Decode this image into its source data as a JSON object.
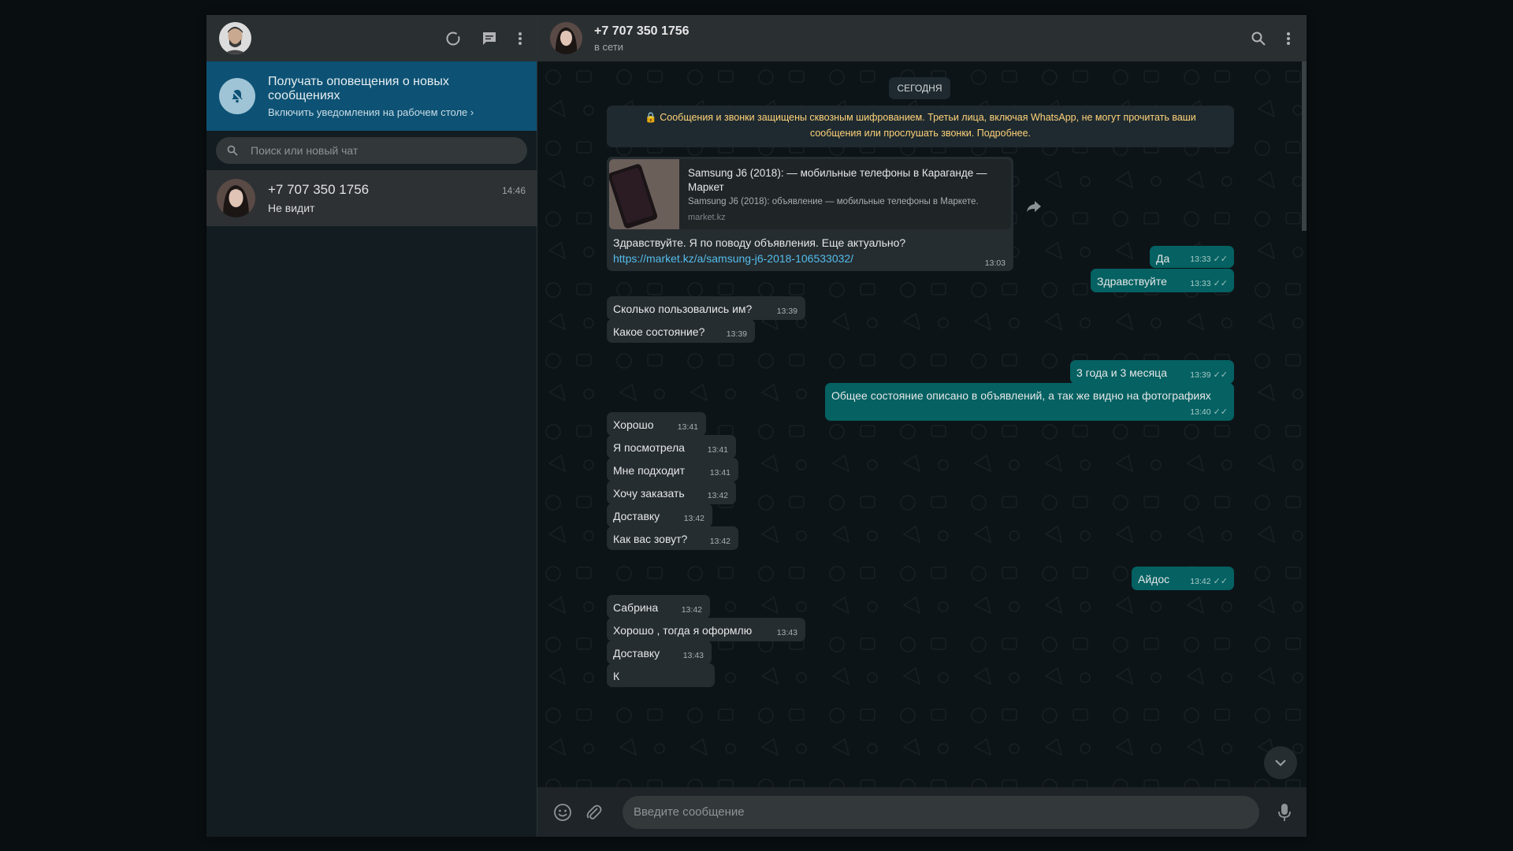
{
  "sidebar": {
    "notification": {
      "title": "Получать оповещения о новых сообщениях",
      "subtitle": "Включить уведомления на рабочем столе ›"
    },
    "search_placeholder": "Поиск или новый чат",
    "chats": [
      {
        "name": "+7 707 350 1756",
        "time": "14:46",
        "last": "Не видит"
      }
    ]
  },
  "conversation": {
    "name": "+7 707 350 1756",
    "status": "в сети",
    "day_label": "СЕГОДНЯ",
    "encryption_notice": "🔒 Сообщения и звонки защищены сквозным шифрованием. Третьи лица, включая WhatsApp, не могут прочитать ваши сообщения или прослушать звонки. Подробнее.",
    "link_message": {
      "preview_title": "Samsung J6 (2018): — мобильные телефоны в Караганде — Маркет",
      "preview_desc": "Samsung J6 (2018): объявление — мобильные телефоны в Маркете.",
      "preview_site": "market.kz",
      "text": "Здравствуйте. Я по поводу объявления. Еще актуально?",
      "url": "https://market.kz/a/samsung-j6-2018-106533032/",
      "time": "13:03"
    },
    "messages": [
      {
        "dir": "out",
        "text": "Да",
        "time": "13:33"
      },
      {
        "dir": "out",
        "text": "Здравствуйте",
        "time": "13:33"
      },
      {
        "dir": "in",
        "text": "Сколько пользовались им?",
        "time": "13:39"
      },
      {
        "dir": "in",
        "text": "Какое состояние?",
        "time": "13:39"
      },
      {
        "dir": "out",
        "text": "3 года и 3 месяца",
        "time": "13:39"
      },
      {
        "dir": "out",
        "text": "Общее состояние описано в объявлений, а так же видно на фотографиях",
        "time": "13:40"
      },
      {
        "dir": "in",
        "text": "Хорошо",
        "time": "13:41"
      },
      {
        "dir": "in",
        "text": "Я посмотрела",
        "time": "13:41"
      },
      {
        "dir": "in",
        "text": "Мне подходит",
        "time": "13:41"
      },
      {
        "dir": "in",
        "text": "Хочу заказать",
        "time": "13:42"
      },
      {
        "dir": "in",
        "text": "Доставку",
        "time": "13:42"
      },
      {
        "dir": "in",
        "text": "Как вас зовут?",
        "time": "13:42"
      },
      {
        "dir": "out",
        "text": "Айдос",
        "time": "13:42"
      },
      {
        "dir": "in",
        "text": "Сабрина",
        "time": "13:42"
      },
      {
        "dir": "in",
        "text": "Хорошо , тогда я оформлю",
        "time": "13:43"
      },
      {
        "dir": "in",
        "text": "Доставку",
        "time": "13:43"
      },
      {
        "dir": "in",
        "text": "К",
        "time": ""
      }
    ],
    "composer_placeholder": "Введите сообщение"
  },
  "colors": {
    "outgoing": "#056162",
    "incoming": "#262d31",
    "notification_bar": "#0d5274"
  }
}
